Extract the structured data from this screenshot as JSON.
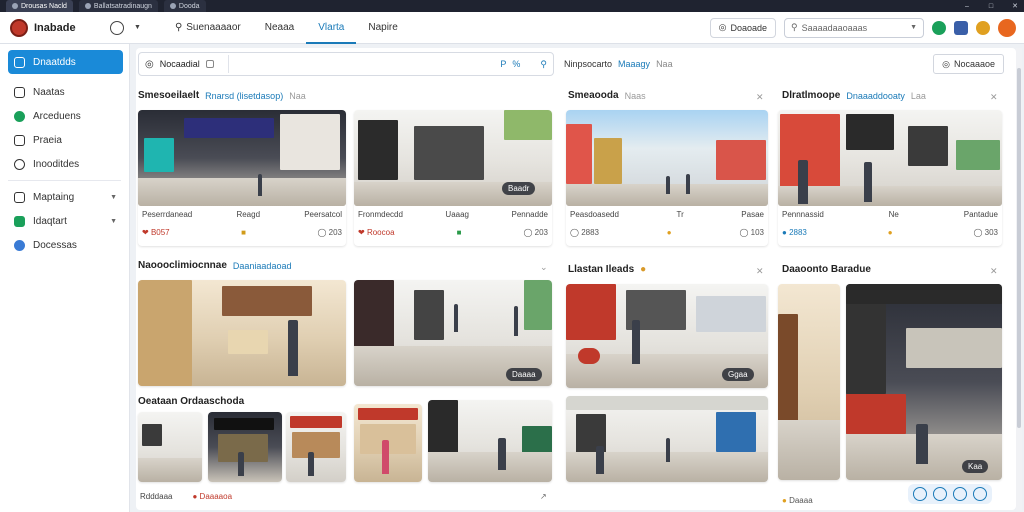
{
  "browser": {
    "tabs": [
      {
        "label": "Drousas Nacld"
      },
      {
        "label": "Ballatsatradinaugn"
      },
      {
        "label": "Dooda"
      }
    ]
  },
  "topbar": {
    "brand": "Inabade",
    "nav": [
      "Suenaaaaor",
      "Neaaa",
      "Vlarta",
      "Napire"
    ],
    "share_label": "Doaoade",
    "search_placeholder": "Saaaadaaoaaas"
  },
  "sidebar": {
    "items": [
      {
        "label": "Dnaatdds"
      },
      {
        "label": "Naatas"
      },
      {
        "label": "Arceduens"
      },
      {
        "label": "Praeia"
      },
      {
        "label": "Inooditdes"
      },
      {
        "label": "Maptaing"
      },
      {
        "label": "Idaqtart"
      },
      {
        "label": "Docessas"
      }
    ]
  },
  "filter": {
    "label": "Nocaadial",
    "actions": [
      "P",
      "%"
    ],
    "search_icon": "search-icon"
  },
  "rightbar": {
    "text": "Ninpsocarto",
    "accent": "Maaagy",
    "muted": "Naa",
    "sort_label": "Nocaaaoe"
  },
  "sections": [
    {
      "title": "Smesoeilaelt",
      "sub": "Rnarsd (lisetdasop)",
      "muted": "Naa",
      "cards": [
        {
          "badge": "",
          "meta": [
            "Peserrdanead",
            "Reagd",
            "Peersatcol"
          ],
          "stats": [
            "B057",
            "■",
            "203"
          ]
        },
        {
          "badge": "Baadr",
          "meta": [
            "Fronmdecdd",
            "Uaaag",
            "Pennadde"
          ],
          "stats": [
            "Roocoa",
            "■",
            "203"
          ]
        }
      ]
    },
    {
      "title": "Smeaooda",
      "sub": "",
      "muted": "Naas",
      "cards": [
        {
          "badge": "",
          "meta": [
            "Peasdoasedd",
            "Tr",
            "Pasae"
          ],
          "stats": [
            "2883",
            "●",
            "103"
          ]
        },
        {
          "badge": "",
          "meta": [
            "Pennnassid",
            "Ne",
            "Pantadue"
          ],
          "stats": [
            "2883",
            "●",
            "303"
          ]
        }
      ]
    },
    {
      "title": "Dlratlmoope",
      "sub": "Dnaaaddooaty",
      "muted": "Laa",
      "cards": []
    },
    {
      "title": "Naoooclimiocnnae",
      "sub": "Daaniaadaoad",
      "muted": "",
      "cards": [
        {
          "badge": "Daaaa",
          "meta": [],
          "stats": []
        }
      ]
    },
    {
      "title": "Llastan Ileads",
      "sub": "",
      "muted": "",
      "cards": [
        {
          "badge": "Ggaa",
          "meta": [],
          "stats": []
        }
      ]
    },
    {
      "title": "Daaoonto Baradue",
      "sub": "",
      "muted": "",
      "cards": [
        {
          "badge": "Kaa",
          "meta": [],
          "stats": []
        }
      ]
    },
    {
      "title": "Oeataan Ordaaschoda",
      "sub": "",
      "muted": "",
      "cards": [
        {
          "badge": "",
          "meta": [
            "Rdddaaa"
          ],
          "stats": [
            "Daaaaoa"
          ]
        }
      ]
    }
  ],
  "footer": {
    "stat": "Daaaa"
  },
  "colors": {
    "accent": "#1a8ad8",
    "brand": "#c0392b",
    "green": "#1aa05a"
  }
}
